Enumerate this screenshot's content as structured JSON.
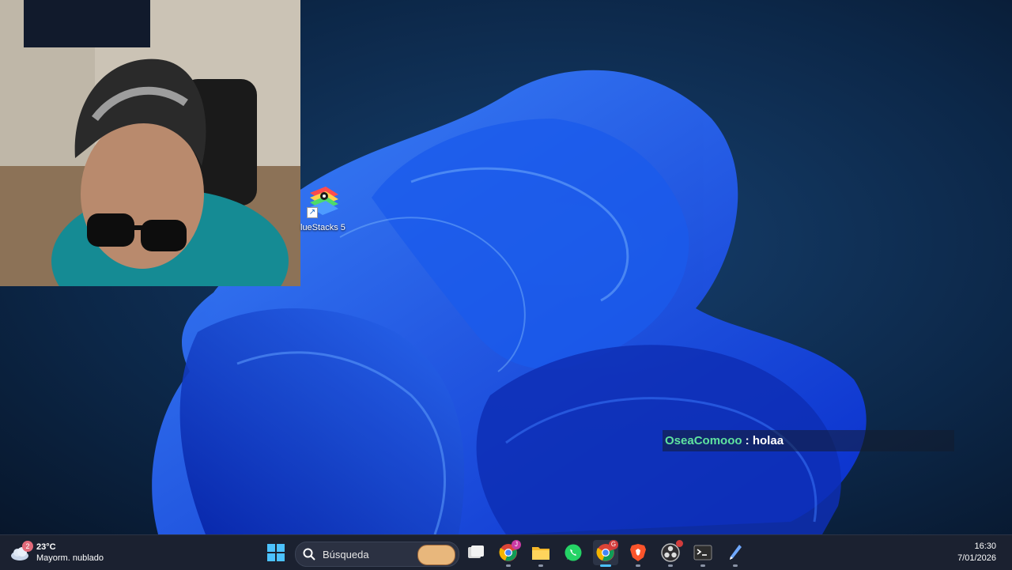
{
  "desktop": {
    "icons": [
      {
        "label": "lueStacks 5",
        "icon": "bluestacks-icon"
      }
    ]
  },
  "chat": {
    "username": "OseaComooo",
    "separator": " : ",
    "message": "holaa"
  },
  "taskbar": {
    "weather": {
      "badge": "2",
      "temperature": "23°C",
      "condition": "Mayorm. nublado",
      "icon": "cloudy-weather-icon"
    },
    "search_placeholder": "Búsqueda",
    "apps": [
      {
        "name": "start",
        "icon": "windows-start-icon"
      },
      {
        "name": "task-view",
        "icon": "task-view-icon"
      },
      {
        "name": "chrome-1",
        "icon": "chrome-icon",
        "badge": "J"
      },
      {
        "name": "file-explorer",
        "icon": "folder-icon"
      },
      {
        "name": "whatsapp",
        "icon": "whatsapp-icon"
      },
      {
        "name": "chrome-2",
        "icon": "chrome-icon",
        "badge": "G"
      },
      {
        "name": "brave",
        "icon": "brave-icon"
      },
      {
        "name": "obs",
        "icon": "obs-icon"
      },
      {
        "name": "terminal",
        "icon": "terminal-icon"
      },
      {
        "name": "pen-app",
        "icon": "pen-icon"
      }
    ],
    "clock": {
      "time": "16:30",
      "date": "7/01/2026"
    }
  },
  "colors": {
    "chat_username": "#5fe3a0",
    "taskbar_bg": "#1b2130",
    "accent": "#4cc2ff"
  }
}
